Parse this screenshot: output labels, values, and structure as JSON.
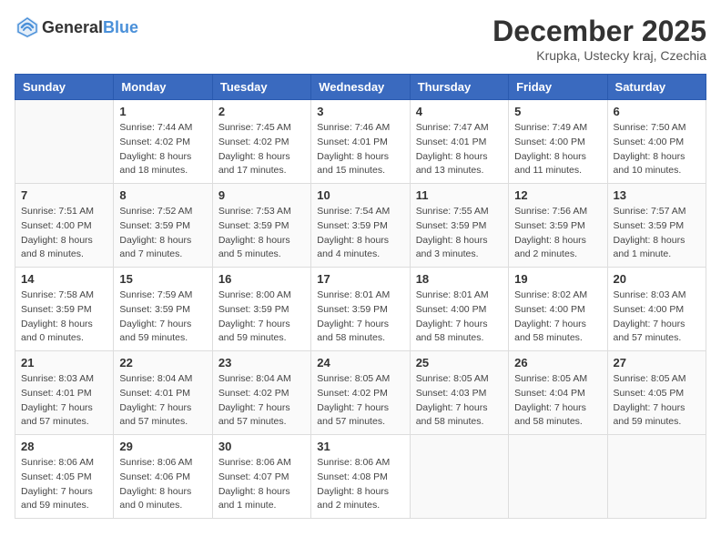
{
  "header": {
    "logo_general": "General",
    "logo_blue": "Blue",
    "month": "December 2025",
    "location": "Krupka, Ustecky kraj, Czechia"
  },
  "days_of_week": [
    "Sunday",
    "Monday",
    "Tuesday",
    "Wednesday",
    "Thursday",
    "Friday",
    "Saturday"
  ],
  "weeks": [
    [
      {
        "day": "",
        "sunrise": "",
        "sunset": "",
        "daylight": ""
      },
      {
        "day": "1",
        "sunrise": "Sunrise: 7:44 AM",
        "sunset": "Sunset: 4:02 PM",
        "daylight": "Daylight: 8 hours and 18 minutes."
      },
      {
        "day": "2",
        "sunrise": "Sunrise: 7:45 AM",
        "sunset": "Sunset: 4:02 PM",
        "daylight": "Daylight: 8 hours and 17 minutes."
      },
      {
        "day": "3",
        "sunrise": "Sunrise: 7:46 AM",
        "sunset": "Sunset: 4:01 PM",
        "daylight": "Daylight: 8 hours and 15 minutes."
      },
      {
        "day": "4",
        "sunrise": "Sunrise: 7:47 AM",
        "sunset": "Sunset: 4:01 PM",
        "daylight": "Daylight: 8 hours and 13 minutes."
      },
      {
        "day": "5",
        "sunrise": "Sunrise: 7:49 AM",
        "sunset": "Sunset: 4:00 PM",
        "daylight": "Daylight: 8 hours and 11 minutes."
      },
      {
        "day": "6",
        "sunrise": "Sunrise: 7:50 AM",
        "sunset": "Sunset: 4:00 PM",
        "daylight": "Daylight: 8 hours and 10 minutes."
      }
    ],
    [
      {
        "day": "7",
        "sunrise": "Sunrise: 7:51 AM",
        "sunset": "Sunset: 4:00 PM",
        "daylight": "Daylight: 8 hours and 8 minutes."
      },
      {
        "day": "8",
        "sunrise": "Sunrise: 7:52 AM",
        "sunset": "Sunset: 3:59 PM",
        "daylight": "Daylight: 8 hours and 7 minutes."
      },
      {
        "day": "9",
        "sunrise": "Sunrise: 7:53 AM",
        "sunset": "Sunset: 3:59 PM",
        "daylight": "Daylight: 8 hours and 5 minutes."
      },
      {
        "day": "10",
        "sunrise": "Sunrise: 7:54 AM",
        "sunset": "Sunset: 3:59 PM",
        "daylight": "Daylight: 8 hours and 4 minutes."
      },
      {
        "day": "11",
        "sunrise": "Sunrise: 7:55 AM",
        "sunset": "Sunset: 3:59 PM",
        "daylight": "Daylight: 8 hours and 3 minutes."
      },
      {
        "day": "12",
        "sunrise": "Sunrise: 7:56 AM",
        "sunset": "Sunset: 3:59 PM",
        "daylight": "Daylight: 8 hours and 2 minutes."
      },
      {
        "day": "13",
        "sunrise": "Sunrise: 7:57 AM",
        "sunset": "Sunset: 3:59 PM",
        "daylight": "Daylight: 8 hours and 1 minute."
      }
    ],
    [
      {
        "day": "14",
        "sunrise": "Sunrise: 7:58 AM",
        "sunset": "Sunset: 3:59 PM",
        "daylight": "Daylight: 8 hours and 0 minutes."
      },
      {
        "day": "15",
        "sunrise": "Sunrise: 7:59 AM",
        "sunset": "Sunset: 3:59 PM",
        "daylight": "Daylight: 7 hours and 59 minutes."
      },
      {
        "day": "16",
        "sunrise": "Sunrise: 8:00 AM",
        "sunset": "Sunset: 3:59 PM",
        "daylight": "Daylight: 7 hours and 59 minutes."
      },
      {
        "day": "17",
        "sunrise": "Sunrise: 8:01 AM",
        "sunset": "Sunset: 3:59 PM",
        "daylight": "Daylight: 7 hours and 58 minutes."
      },
      {
        "day": "18",
        "sunrise": "Sunrise: 8:01 AM",
        "sunset": "Sunset: 4:00 PM",
        "daylight": "Daylight: 7 hours and 58 minutes."
      },
      {
        "day": "19",
        "sunrise": "Sunrise: 8:02 AM",
        "sunset": "Sunset: 4:00 PM",
        "daylight": "Daylight: 7 hours and 58 minutes."
      },
      {
        "day": "20",
        "sunrise": "Sunrise: 8:03 AM",
        "sunset": "Sunset: 4:00 PM",
        "daylight": "Daylight: 7 hours and 57 minutes."
      }
    ],
    [
      {
        "day": "21",
        "sunrise": "Sunrise: 8:03 AM",
        "sunset": "Sunset: 4:01 PM",
        "daylight": "Daylight: 7 hours and 57 minutes."
      },
      {
        "day": "22",
        "sunrise": "Sunrise: 8:04 AM",
        "sunset": "Sunset: 4:01 PM",
        "daylight": "Daylight: 7 hours and 57 minutes."
      },
      {
        "day": "23",
        "sunrise": "Sunrise: 8:04 AM",
        "sunset": "Sunset: 4:02 PM",
        "daylight": "Daylight: 7 hours and 57 minutes."
      },
      {
        "day": "24",
        "sunrise": "Sunrise: 8:05 AM",
        "sunset": "Sunset: 4:02 PM",
        "daylight": "Daylight: 7 hours and 57 minutes."
      },
      {
        "day": "25",
        "sunrise": "Sunrise: 8:05 AM",
        "sunset": "Sunset: 4:03 PM",
        "daylight": "Daylight: 7 hours and 58 minutes."
      },
      {
        "day": "26",
        "sunrise": "Sunrise: 8:05 AM",
        "sunset": "Sunset: 4:04 PM",
        "daylight": "Daylight: 7 hours and 58 minutes."
      },
      {
        "day": "27",
        "sunrise": "Sunrise: 8:05 AM",
        "sunset": "Sunset: 4:05 PM",
        "daylight": "Daylight: 7 hours and 59 minutes."
      }
    ],
    [
      {
        "day": "28",
        "sunrise": "Sunrise: 8:06 AM",
        "sunset": "Sunset: 4:05 PM",
        "daylight": "Daylight: 7 hours and 59 minutes."
      },
      {
        "day": "29",
        "sunrise": "Sunrise: 8:06 AM",
        "sunset": "Sunset: 4:06 PM",
        "daylight": "Daylight: 8 hours and 0 minutes."
      },
      {
        "day": "30",
        "sunrise": "Sunrise: 8:06 AM",
        "sunset": "Sunset: 4:07 PM",
        "daylight": "Daylight: 8 hours and 1 minute."
      },
      {
        "day": "31",
        "sunrise": "Sunrise: 8:06 AM",
        "sunset": "Sunset: 4:08 PM",
        "daylight": "Daylight: 8 hours and 2 minutes."
      },
      {
        "day": "",
        "sunrise": "",
        "sunset": "",
        "daylight": ""
      },
      {
        "day": "",
        "sunrise": "",
        "sunset": "",
        "daylight": ""
      },
      {
        "day": "",
        "sunrise": "",
        "sunset": "",
        "daylight": ""
      }
    ]
  ]
}
